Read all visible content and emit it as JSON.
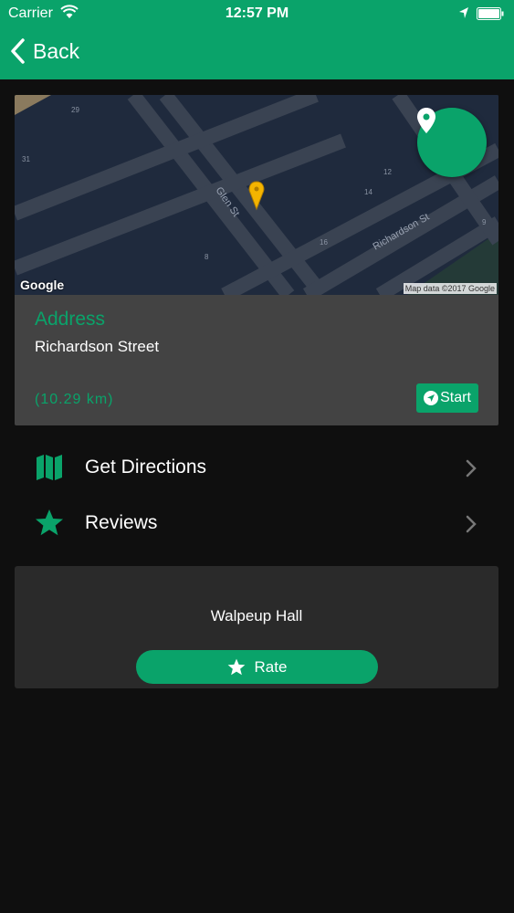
{
  "status_bar": {
    "carrier": "Carrier",
    "time": "12:57 PM"
  },
  "nav": {
    "back_label": "Back"
  },
  "map": {
    "provider_logo": "Google",
    "attribution": "Map data ©2017 Google",
    "street_labels": [
      "Glen St",
      "Richardson St"
    ],
    "number_labels": [
      "29",
      "31",
      "12",
      "14",
      "16",
      "8",
      "9"
    ],
    "marker_color": "#f4b400"
  },
  "location": {
    "address_title": "Address",
    "address_value": "Richardson Street",
    "distance": "(10.29 km)",
    "start_label": "Start"
  },
  "menu": {
    "directions_label": "Get Directions",
    "reviews_label": "Reviews"
  },
  "rating": {
    "place_name": "Walpeup Hall",
    "rate_label": "Rate"
  },
  "colors": {
    "accent": "#0aa36a",
    "background": "#0f0f0f",
    "card": "#434343",
    "map": "#1f2a3d"
  },
  "icons": [
    "wifi-icon",
    "location-arrow-icon",
    "battery-icon",
    "back-chevron-icon",
    "map-pin-icon",
    "navigation-arrow-icon",
    "map-icon",
    "star-icon",
    "chevron-right-icon"
  ]
}
